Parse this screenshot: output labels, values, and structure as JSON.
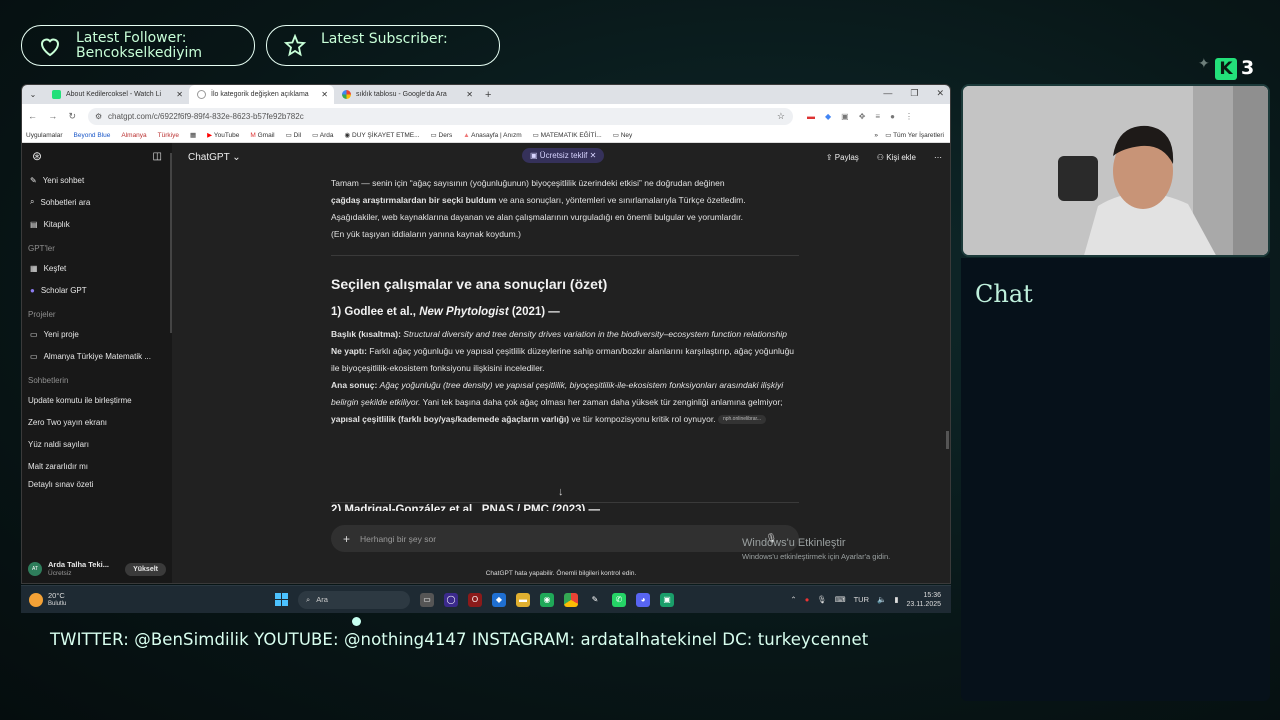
{
  "overlay": {
    "follower": {
      "label": "Latest Follower:",
      "name": "Bencokselkediyim"
    },
    "subscriber": {
      "label": "Latest Subscriber:",
      "name": ""
    },
    "kick_logo": "K",
    "kick_count": "3",
    "chat_title": "Chat",
    "ticker": "TWITTER: @BenSimdilik   YOUTUBE: @nothing4147   INSTAGRAM: ardatalhatekinel   DC: turkeycennet",
    "colors": {
      "accent": "#c8ffd8",
      "kick_green": "#23e07a",
      "chat_text": "#bff0dc"
    }
  },
  "browser": {
    "tabs": [
      {
        "title": "About Kedilercoksel - Watch Li",
        "icon": "kick-icon",
        "active": false
      },
      {
        "title": "İlo kategorik değişken açıklama",
        "icon": "chatgpt-icon",
        "active": true
      },
      {
        "title": "sıklık tablosu - Google'da Ara",
        "icon": "google-icon",
        "active": false
      }
    ],
    "url": "chatgpt.com/c/6922f6f9-89f4-832e-8623-b57fe92b782c",
    "bookmarks": [
      "Uygulamalar",
      "Beyond Blue",
      "Almanya",
      "Türkiye",
      "YouTube",
      "Gmail",
      "Dil",
      "Arda",
      "DUY ŞİKAYET ETME...",
      "Ders",
      "Anasayfa | Anızm",
      "MATEMATIK EĞİTİ...",
      "Ney"
    ],
    "bookmarks_right": "Tüm Yer İşaretleri"
  },
  "sidebar": {
    "actions": [
      "Yeni sohbet",
      "Sohbetleri ara",
      "Kitaplık"
    ],
    "gpts_header": "GPT'ler",
    "gpts": [
      "Keşfet",
      "Scholar GPT"
    ],
    "projects_header": "Projeler",
    "projects": [
      "Yeni proje",
      "Almanya Türkiye Matematik ..."
    ],
    "chats_header": "Sohbetlerin",
    "chats": [
      "Update komutu ile birleştirme",
      "Zero Two yayın ekranı",
      "Yüz naldi sayıları",
      "Malt zararlıdır mı",
      "Detaylı sınav özeti"
    ],
    "user": {
      "initials": "AT",
      "name": "Arda Talha Teki...",
      "plan": "Ücretsiz",
      "upgrade": "Yükselt"
    }
  },
  "main": {
    "model": "ChatGPT",
    "offer": "Ücretsiz teklif",
    "share": "Paylaş",
    "add_person": "Kişi ekle",
    "intro_a": "Tamam — senin için “ağaç sayısının (yoğunluğunun) biyoçeşitlilik üzerindeki etkisi” ne doğrudan değinen",
    "intro_b_bold": "çağdaş araştırmalardan bir seçki buldum",
    "intro_b_rest": " ve ana sonuçları, yöntemleri ve sınırlamalarıyla Türkçe özetledim.",
    "intro_c": "Aşağıdakiler, web kaynaklarına dayanan ve alan çalışmalarının vurguladığı en önemli bulgular ve yorumlardır.",
    "intro_d": "(En yük taşıyan iddiaların yanına kaynak koydum.)",
    "section_title": "Seçilen çalışmalar ve ana sonuçları (özet)",
    "study1": {
      "num": "1) Godlee et al., ",
      "journal": "New Phytologist",
      "year": " (2021) —",
      "title_label": "Başlık (kısaltma):",
      "title": "Structural diversity and tree density drives variation in the biodiversity–ecosystem function relationship",
      "did_label": "Ne yaptı:",
      "did": " Farklı ağaç yoğunluğu ve yapısal çeşitlilik düzeylerine sahip orman/bozkır alanlarını karşılaştırıp, ağaç yoğunluğu ile biyoçeşitlilik-ekosistem fonksiyonu ilişkisini incelediler.",
      "result_label": "Ana sonuç:",
      "result_italic": "Ağaç yoğunluğu (tree density) ve yapısal çeşitlilik, biyoçeşitlilik-ile-ekosistem fonksiyonları arasındaki ilişkiyi belirgin şekilde etkiliyor.",
      "result_rest": " Yani tek başına daha çok ağaç olması her zaman daha yüksek tür zenginliği anlamına gelmiyor; ",
      "result_bold": "yapısal çeşitlilik (farklı boy/yaş/kademede ağaçların varlığı)",
      "result_end": " ve tür kompozisyonu kritik rol oynuyor.",
      "pill": "nph.onlinelibrar..."
    },
    "study2_head": "2) Madrigal-González et al., PNAS / PMC (2023) —",
    "input_placeholder": "Herhangi bir şey sor",
    "footnote": "ChatGPT hata yapabilir. Önemli bilgileri kontrol edin.",
    "watermark_title": "Windows'u Etkinleştir",
    "watermark_sub": "Windows'u etkinleştirmek için Ayarlar'a gidin."
  },
  "taskbar": {
    "temp": "20°C",
    "condition": "Bulutlu",
    "search": "Ara",
    "lang": "TUR",
    "time": "15:36",
    "date": "23.11.2025"
  }
}
